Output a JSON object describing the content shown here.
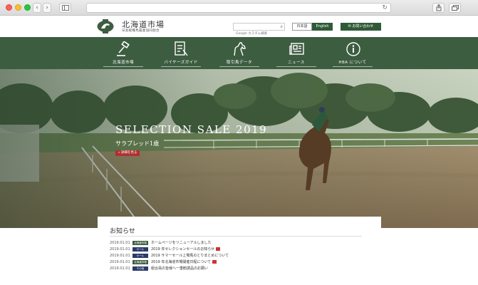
{
  "browser": {
    "url": "",
    "back_glyph": "‹",
    "forward_glyph": "›",
    "reload_glyph": "↻"
  },
  "header": {
    "logo_title": "北海道市場",
    "logo_subtitle": "日高軽種馬農業協同組合",
    "search_placeholder": "Google カスタム検索",
    "lang_ja": "日本語",
    "lang_en": "English",
    "contact_label": "✉ お問い合わせ"
  },
  "nav": {
    "items": [
      {
        "label": "北海道市場",
        "icon": "gavel-icon"
      },
      {
        "label": "バイヤーズガイド",
        "icon": "guide-icon"
      },
      {
        "label": "取引馬データ",
        "icon": "horse-icon"
      },
      {
        "label": "ニュース",
        "icon": "news-icon"
      },
      {
        "label": "HBA について",
        "icon": "info-icon"
      }
    ]
  },
  "hero": {
    "title": "SELECTION SALE 2019",
    "subtitle": "サラブレッド1歳",
    "button_label": "» 詳細を見る"
  },
  "news": {
    "heading": "お知らせ",
    "items": [
      {
        "date": "2019.01.01",
        "tag": "北海道市場",
        "tag_color": "#3d5d40",
        "text": "ホームページをリニューアルしました",
        "is_new": false
      },
      {
        "date": "2019.01.01",
        "tag": "セール",
        "tag_color": "#2b3a6b",
        "text": "2019 年セレクションセールのお知らせ",
        "is_new": true
      },
      {
        "date": "2019.01.01",
        "tag": "セール",
        "tag_color": "#2b3a6b",
        "text": "2019 サマーセール上場馬のとりまとめについて",
        "is_new": false
      },
      {
        "date": "2019.01.01",
        "tag": "北海道市場",
        "tag_color": "#3d5d40",
        "text": "2019 年北海道市場開催日程について",
        "is_new": true
      },
      {
        "date": "2019.01.01",
        "tag": "その他",
        "tag_color": "#2b3a6b",
        "text": "組合員の皆様へ一重勧誘品のお願い",
        "is_new": false
      }
    ]
  }
}
